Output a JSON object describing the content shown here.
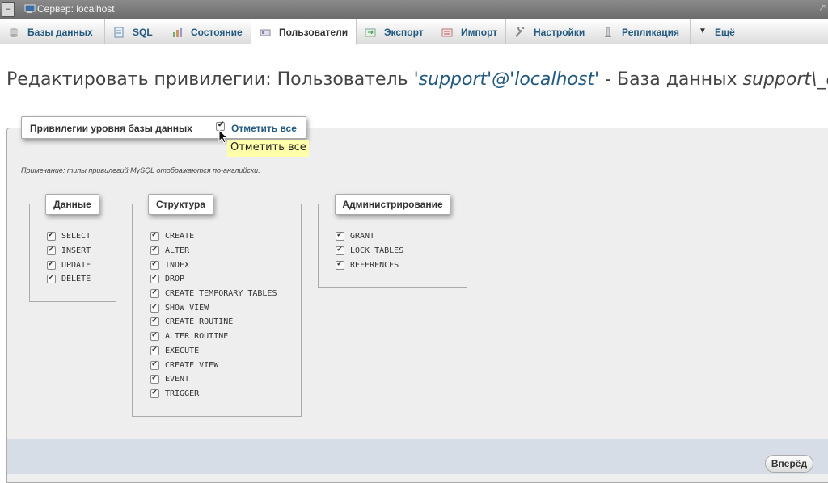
{
  "window": {
    "title": "Сервер: localhost"
  },
  "menu": {
    "tabs": [
      {
        "label": "Базы данных",
        "icon": "databases-icon",
        "active": false
      },
      {
        "label": "SQL",
        "icon": "sql-icon",
        "active": false
      },
      {
        "label": "Состояние",
        "icon": "status-icon",
        "active": false
      },
      {
        "label": "Пользователи",
        "icon": "users-icon",
        "active": true
      },
      {
        "label": "Экспорт",
        "icon": "export-icon",
        "active": false
      },
      {
        "label": "Импорт",
        "icon": "import-icon",
        "active": false
      },
      {
        "label": "Настройки",
        "icon": "settings-icon",
        "active": false
      },
      {
        "label": "Репликация",
        "icon": "replication-icon",
        "active": false
      },
      {
        "label": "Ещё",
        "icon": "chevron-down-icon",
        "active": false
      }
    ]
  },
  "heading": {
    "prefix": "Редактировать привилегии: Пользователь ",
    "user": "'support'@'localhost'",
    "middle": " - База данных ",
    "db": "support\\_db"
  },
  "privileges": {
    "legend": "Привилегии уровня базы данных",
    "check_all_label": "Отметить все",
    "tooltip": "Отметить все",
    "note": "Примечание: типы привилегий MySQL отображаются по-английски.",
    "groups": [
      {
        "title": "Данные",
        "items": [
          "SELECT",
          "INSERT",
          "UPDATE",
          "DELETE"
        ]
      },
      {
        "title": "Структура",
        "items": [
          "CREATE",
          "ALTER",
          "INDEX",
          "DROP",
          "CREATE TEMPORARY TABLES",
          "SHOW VIEW",
          "CREATE ROUTINE",
          "ALTER ROUTINE",
          "EXECUTE",
          "CREATE VIEW",
          "EVENT",
          "TRIGGER"
        ]
      },
      {
        "title": "Администрирование",
        "items": [
          "GRANT",
          "LOCK TABLES",
          "REFERENCES"
        ]
      }
    ]
  },
  "footer": {
    "go_label": "Вперёд"
  },
  "colors": {
    "link": "#235a81",
    "tooltip_bg": "#ffffaa",
    "footer_bg": "#d6dde6"
  }
}
